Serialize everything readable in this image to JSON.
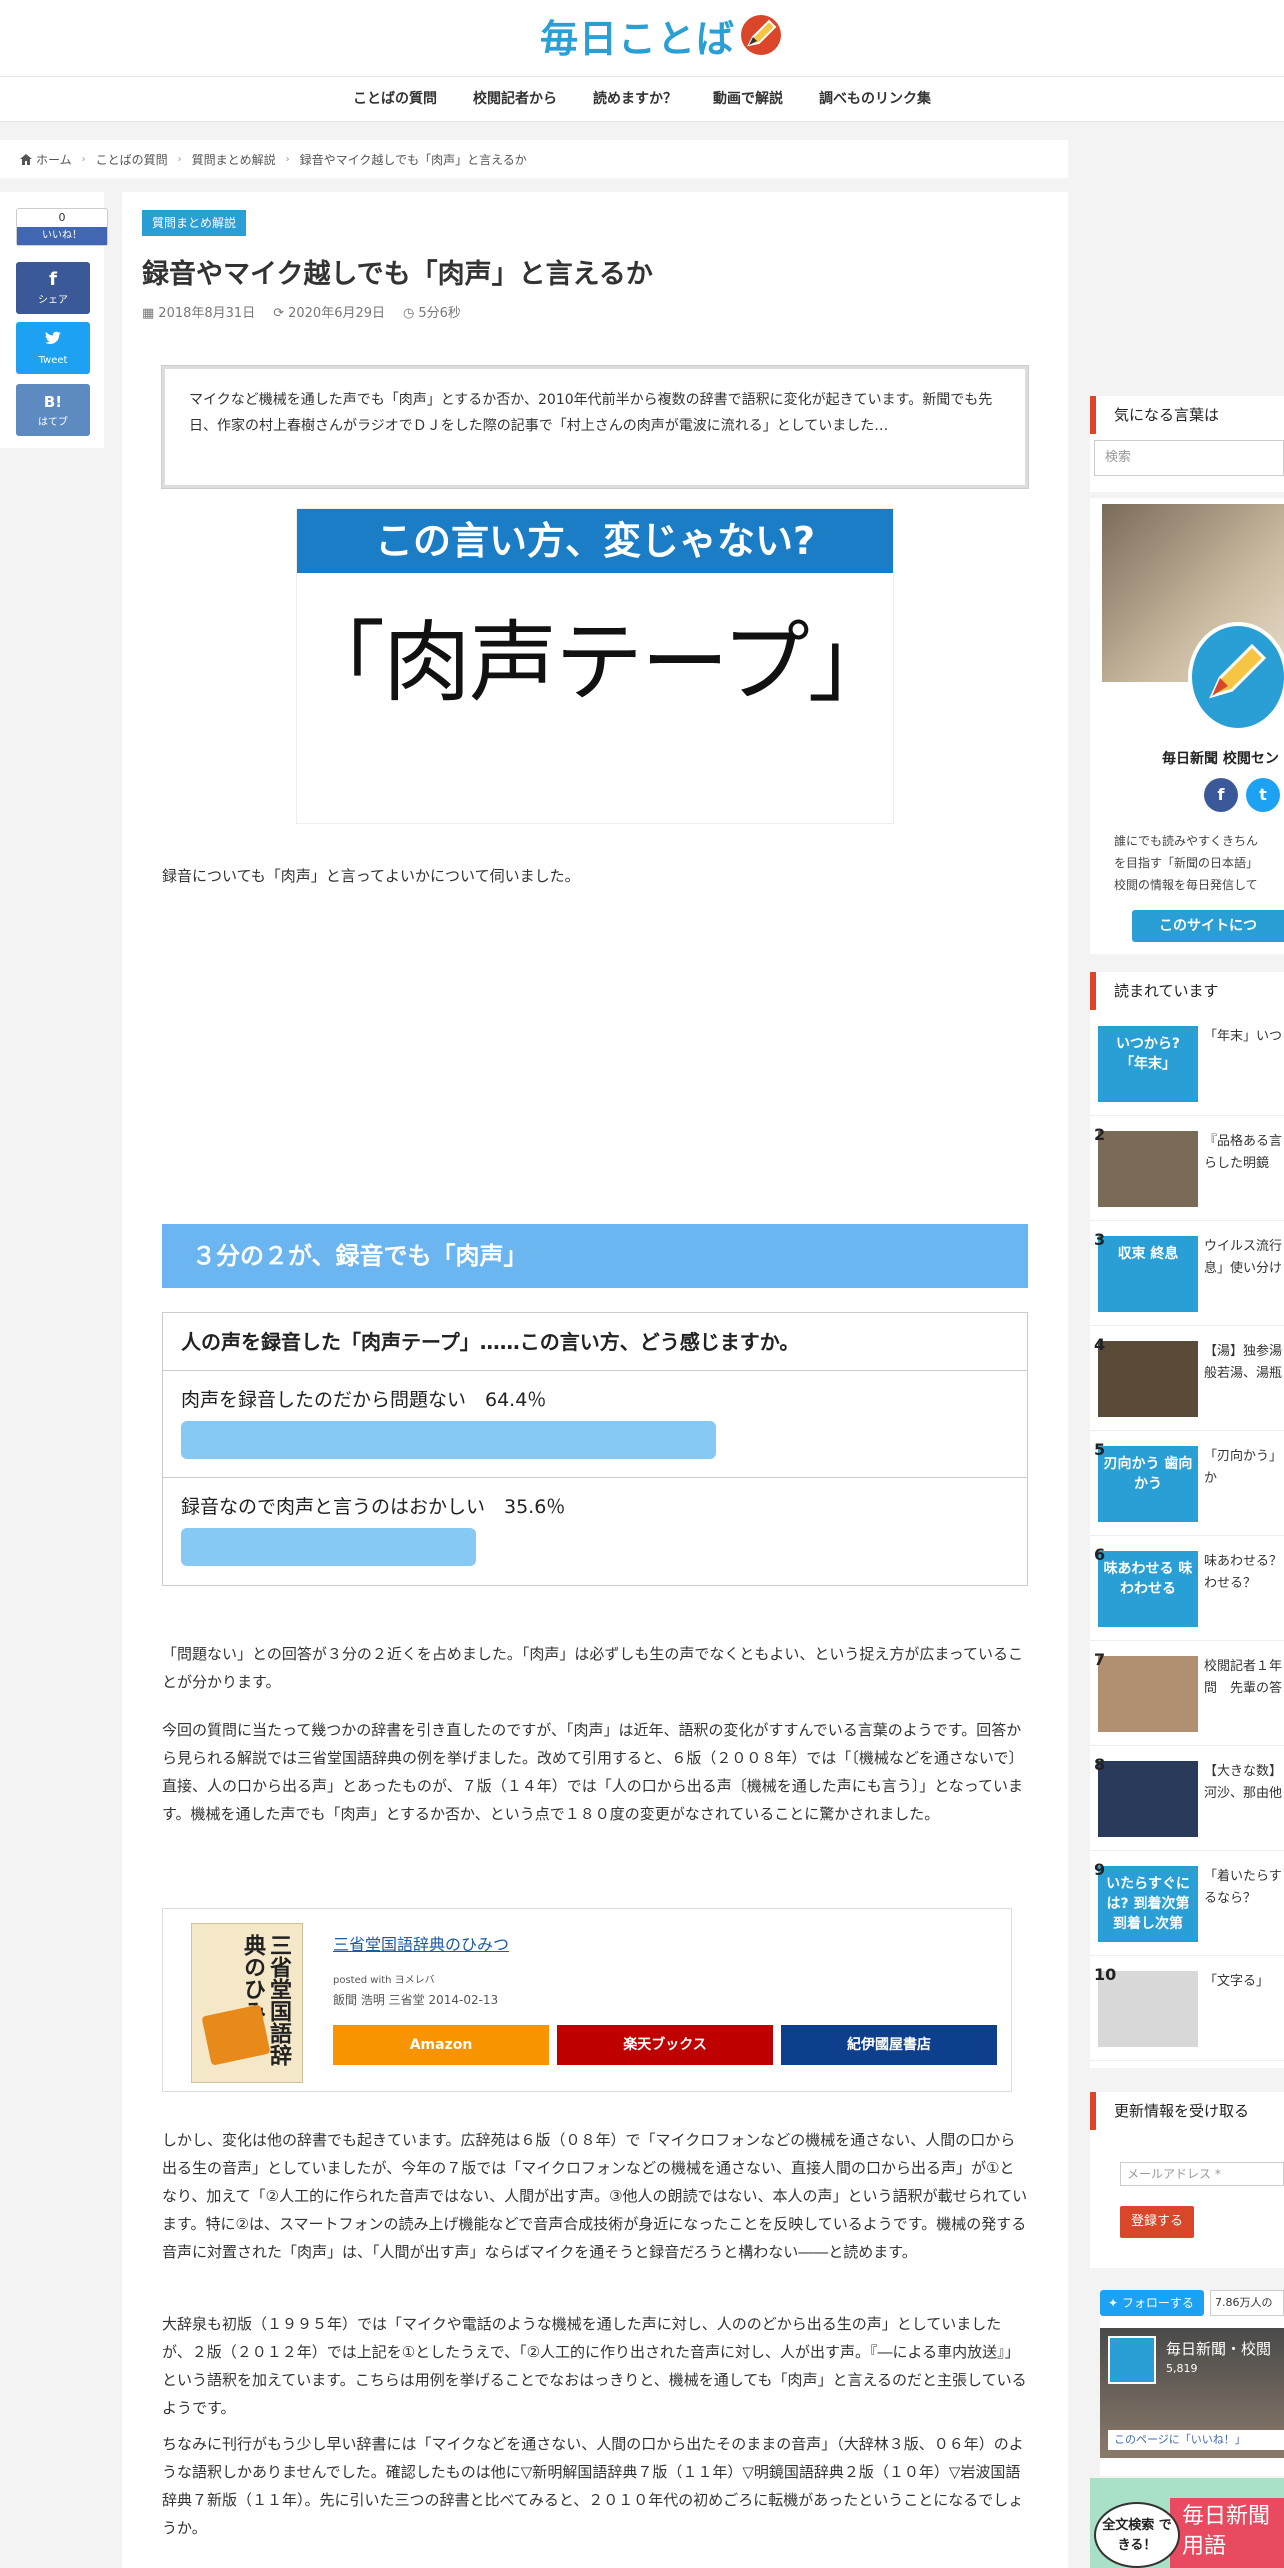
{
  "site": {
    "logo_text": "毎日ことば"
  },
  "nav": [
    "ことばの質問",
    "校閲記者から",
    "読めますか？",
    "動画で解説",
    "調べものリンク集"
  ],
  "breadcrumb": [
    "ホーム",
    "ことばの質問",
    "質問まとめ解説",
    "録音やマイク越しでも「肉声」と言えるか"
  ],
  "share": {
    "like_count": "0",
    "like_label": "いいね！",
    "fb_label": "シェア",
    "tw_label": "Tweet",
    "hb_label": "はてブ",
    "hb_icon": "B!"
  },
  "article": {
    "category": "質問まとめ解説",
    "title": "録音やマイク越しでも「肉声」と言えるか",
    "posted": "2018年8月31日",
    "updated": "2020年6月29日",
    "read_time": "5分6秒",
    "summary": "マイクなど機械を通した声でも「肉声」とするか否か、2010年代前半から複数の辞書で語釈に変化が起きています。新聞でも先日、作家の村上春樹さんがラジオでＤＪをした際の記事で「村上さんの肉声が電波に流れる」としていました…",
    "eyecatch_top": "この言い方、変じゃない?",
    "eyecatch_main": "「肉声テープ」",
    "para1": "録音についても「肉声」と言ってよいかについて伺いました。",
    "h2": "３分の２が、録音でも「肉声」",
    "survey": {
      "question": "人の声を録音した「肉声テープ」……この言い方、どう感じますか。",
      "options": [
        {
          "label": "肉声を録音したのだから問題ない　64.4％",
          "percent": 64.4
        },
        {
          "label": "録音なので肉声と言うのはおかしい　35.6％",
          "percent": 35.6
        }
      ]
    },
    "para2": "「問題ない」との回答が３分の２近くを占めました。「肉声」は必ずしも生の声でなくともよい、という捉え方が広まっていることが分かります。",
    "para3": "今回の質問に当たって幾つかの辞書を引き直したのですが、「肉声」は近年、語釈の変化がすすんでいる言葉のようです。回答から見られる解説では三省堂国語辞典の例を挙げました。改めて引用すると、６版（２００８年）では「〔機械などを通さないで〕直接、人の口から出る声」とあったものが、７版（１４年）では「人の口から出る声〔機械を通した声にも言う〕」となっています。機械を通した声でも「肉声」とするか否か、という点で１８０度の変更がなされていることに驚かされました。",
    "book": {
      "cover_title": "三省堂国語辞典のひみつ",
      "title": "三省堂国語辞典のひみつ",
      "posted": "posted with ヨメレバ",
      "info": "飯間 浩明 三省堂 2014-02-13",
      "buttons": [
        "Amazon",
        "楽天ブックス",
        "紀伊國屋書店"
      ]
    },
    "para4": "しかし、変化は他の辞書でも起きています。広辞苑は６版（０８年）で「マイクロフォンなどの機械を通さない、人間の口から出る生の音声」としていましたが、今年の７版では「マイクロフォンなどの機械を通さない、直接人間の口から出る声」が①となり、加えて「②人工的に作られた音声ではない、人間が出す声。③他人の朗読ではない、本人の声」という語釈が載せられています。特に②は、スマートフォンの読み上げ機能などで音声合成技術が身近になったことを反映しているようです。機械の発する音声に対置された「肉声」は、「人間が出す声」ならばマイクを通そうと録音だろうと構わない――と読めます。",
    "para5": "大辞泉も初版（１９９５年）では「マイクや電話のような機械を通した声に対し、人ののどから出る生の声」としていましたが、２版（２０１２年）では上記を①としたうえで、「②人工的に作り出された音声に対し、人が出す声。『―による車内放送』」という語釈を加えています。こちらは用例を挙げることでなおはっきりと、機械を通しても「肉声」と言えるのだと主張しているようです。",
    "para6": "ちなみに刊行がもう少し早い辞書には「マイクなどを通さない、人間の口から出たそのままの音声」（大辞林３版、０６年）のような語釈しかありませんでした。確認したものは他に▽新明解国語辞典７版（１１年）▽明鏡国語辞典２版（１０年）▽岩波国語辞典７新版（１１年）。先に引いた三つの辞書と比べてみると、２０１０年代の初めごろに転機があったということになるでしょうか。"
  },
  "sidebar": {
    "search_head": "気になる言葉は",
    "search_placeholder": "検索",
    "profile_name": "毎日新聞 校閲セン",
    "profile_desc": "誰にでも読みやすくきちん\nを目指す「新聞の日本語」\n校閲の情報を毎日発信して",
    "about_button": "このサイトにつ",
    "ranking_head": "読まれています",
    "ranking": [
      {
        "num": "",
        "thumb": "いつから?「年末」",
        "text": "「年末」いつ"
      },
      {
        "num": "2",
        "thumb": "",
        "text": "『品格ある言\nらした明鏡"
      },
      {
        "num": "3",
        "thumb": "収束 終息",
        "text": "ウイルス流行\n息」使い分け"
      },
      {
        "num": "4",
        "thumb": "",
        "text": "【湯】独参湯\n般若湯、湯瓶"
      },
      {
        "num": "5",
        "thumb": "刃向かう 歯向かう",
        "text": "「刃向かう」\nか"
      },
      {
        "num": "6",
        "thumb": "味あわせる 味わわせる",
        "text": "味あわせる？\nわせる？"
      },
      {
        "num": "7",
        "thumb": "",
        "text": "校閲記者１年\n問　先輩の答"
      },
      {
        "num": "8",
        "thumb": "",
        "text": "【大きな数】\n河沙、那由他"
      },
      {
        "num": "9",
        "thumb": "いたらすぐには? 到着次第 到着し次第",
        "text": "「着いたらす\nるなら？"
      },
      {
        "num": "10",
        "thumb": "",
        "text": "「文字る」"
      }
    ],
    "subscribe_head": "更新情報を受け取る",
    "email_placeholder": "メールアドレス *",
    "register_button": "登録する",
    "follow_button": "フォローする",
    "follower_count": "7.86万人の",
    "fb_page_name": "毎日新聞・校閲",
    "fb_page_likes": "5,819",
    "fb_page_like_btn": "このページに「いいね！」",
    "bottom_banner": "毎日新聞 用語",
    "bottom_badge": "全文検索 できる！"
  },
  "colors": {
    "accent": "#2a9fd6",
    "heading": "#6bb6f0",
    "bar": "#86c9f5",
    "sidebar_accent": "#d9462a"
  }
}
